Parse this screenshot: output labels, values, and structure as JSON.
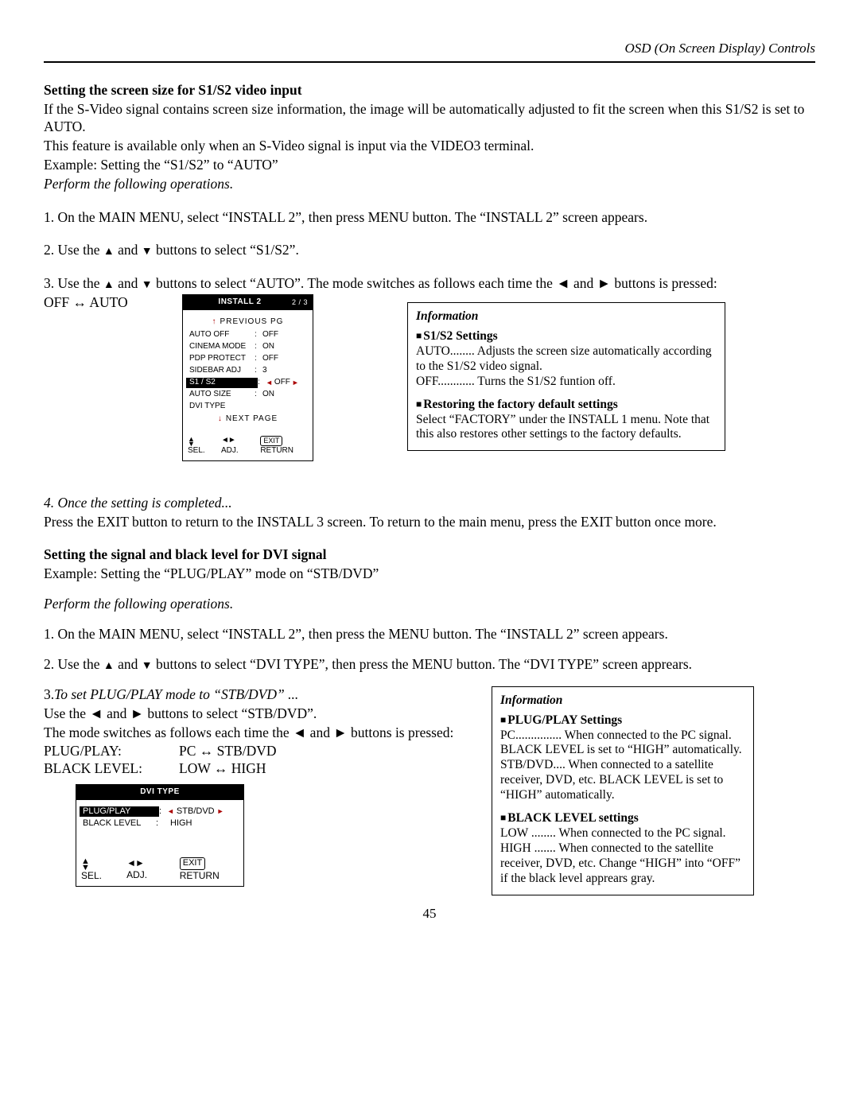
{
  "header": {
    "right": "OSD (On Screen Display) Controls"
  },
  "s1": {
    "heading": "Setting the screen size for S1/S2 video input",
    "p1": "If the S-Video signal contains screen size information, the image will be automatically adjusted to fit the screen when this S1/S2 is set to AUTO.",
    "p2": "This feature is available only when an S-Video signal is input via the VIDEO3 terminal.",
    "p3": "Example:  Setting the “S1/S2” to “AUTO”",
    "perform": "Perform the following operations.",
    "step1": "1. On the MAIN MENU, select “INSTALL 2”, then press MENU button.  The “INSTALL 2” screen appears.",
    "step2a": "2. Use the ",
    "step2b": " buttons to select “S1/S2”.",
    "step3a": "3. Use the ",
    "step3b": " buttons to select “AUTO”.  The mode switches as follows each time the ",
    "step3c": " buttons is pressed:",
    "mode_toggle": "OFF ↔ AUTO",
    "step4_head": "4. Once the setting is completed...",
    "step4_body": "Press the EXIT button to return to the INSTALL 3 screen. To return to the main menu, press the EXIT button once more."
  },
  "osd1": {
    "title": "INSTALL 2",
    "page": "2 / 3",
    "prev": "PREVIOUS PG",
    "rows": [
      {
        "label": "AUTO OFF",
        "val": "OFF"
      },
      {
        "label": "CINEMA MODE",
        "val": "ON"
      },
      {
        "label": "PDP PROTECT",
        "val": "OFF"
      },
      {
        "label": "SIDEBAR ADJ",
        "val": "3"
      }
    ],
    "highlight": {
      "label": "S1 / S2",
      "val": "OFF"
    },
    "rows2": [
      {
        "label": "AUTO SIZE",
        "val": "ON"
      },
      {
        "label": "DVI TYPE",
        "val": ""
      }
    ],
    "next": "NEXT PAGE",
    "footer": {
      "sel": "SEL.",
      "adj": "ADJ.",
      "exit": "EXIT",
      "ret": "RETURN"
    }
  },
  "info1": {
    "title": "Information",
    "sub1": "S1/S2 Settings",
    "l1": "AUTO........ Adjusts the screen size automatically according to the S1/S2 video signal.",
    "l2": "OFF............ Turns the S1/S2 funtion off.",
    "sub2": "Restoring the factory default settings",
    "l3": "Select “FACTORY” under the INSTALL 1 menu.  Note that this also restores other settings to the factory defaults."
  },
  "s2": {
    "heading": "Setting the signal and black level for DVI signal",
    "p1": "Example:  Setting the “PLUG/PLAY” mode on “STB/DVD”",
    "perform": "Perform the following operations.",
    "step1": "1. On the MAIN MENU, select “INSTALL 2”, then press the MENU button. The “INSTALL 2” screen appears.",
    "step2a": "2. Use the ",
    "step2b": " buttons to select “DVI TYPE”, then press the MENU button. The “DVI TYPE” screen apprears.",
    "step3_head": "3.To set PLUG/PLAY mode to “STB/DVD” ...",
    "step3a": "Use the  ",
    "step3b": " buttons to select “STB/DVD”.",
    "step3_mode_a": "The mode switches as follows each time the ",
    "step3_mode_b": " buttons is pressed:",
    "pp_label": "PLUG/PLAY:",
    "pp_val": "PC ↔ STB/DVD",
    "bl_label": "BLACK LEVEL:",
    "bl_val": "LOW ↔ HIGH"
  },
  "osd2": {
    "title": "DVI TYPE",
    "highlight": {
      "label": "PLUG/PLAY",
      "val": "STB/DVD"
    },
    "row": {
      "label": "BLACK LEVEL",
      "val": "HIGH"
    },
    "footer": {
      "sel": "SEL.",
      "adj": "ADJ.",
      "exit": "EXIT",
      "ret": "RETURN"
    }
  },
  "info2": {
    "title": "Information",
    "sub1": "PLUG/PLAY Settings",
    "l1": "PC............... When connected to the PC signal. BLACK LEVEL is set to “HIGH” automatically. STB/DVD.... When connected to a satellite receiver, DVD, etc. BLACK LEVEL is set to “HIGH” automatically.",
    "sub2": "BLACK LEVEL settings",
    "l2": "LOW ........ When connected to the PC signal.",
    "l3": "HIGH ....... When connected to the satellite receiver, DVD, etc. Change “HIGH” into “OFF” if the black level apprears gray."
  },
  "page_number": "45",
  "glyphs": {
    "and": " and ",
    "up": "▲",
    "down": "▼",
    "left": "◄",
    "right": "►",
    "upArr": "↑",
    "downArr": "↓"
  }
}
